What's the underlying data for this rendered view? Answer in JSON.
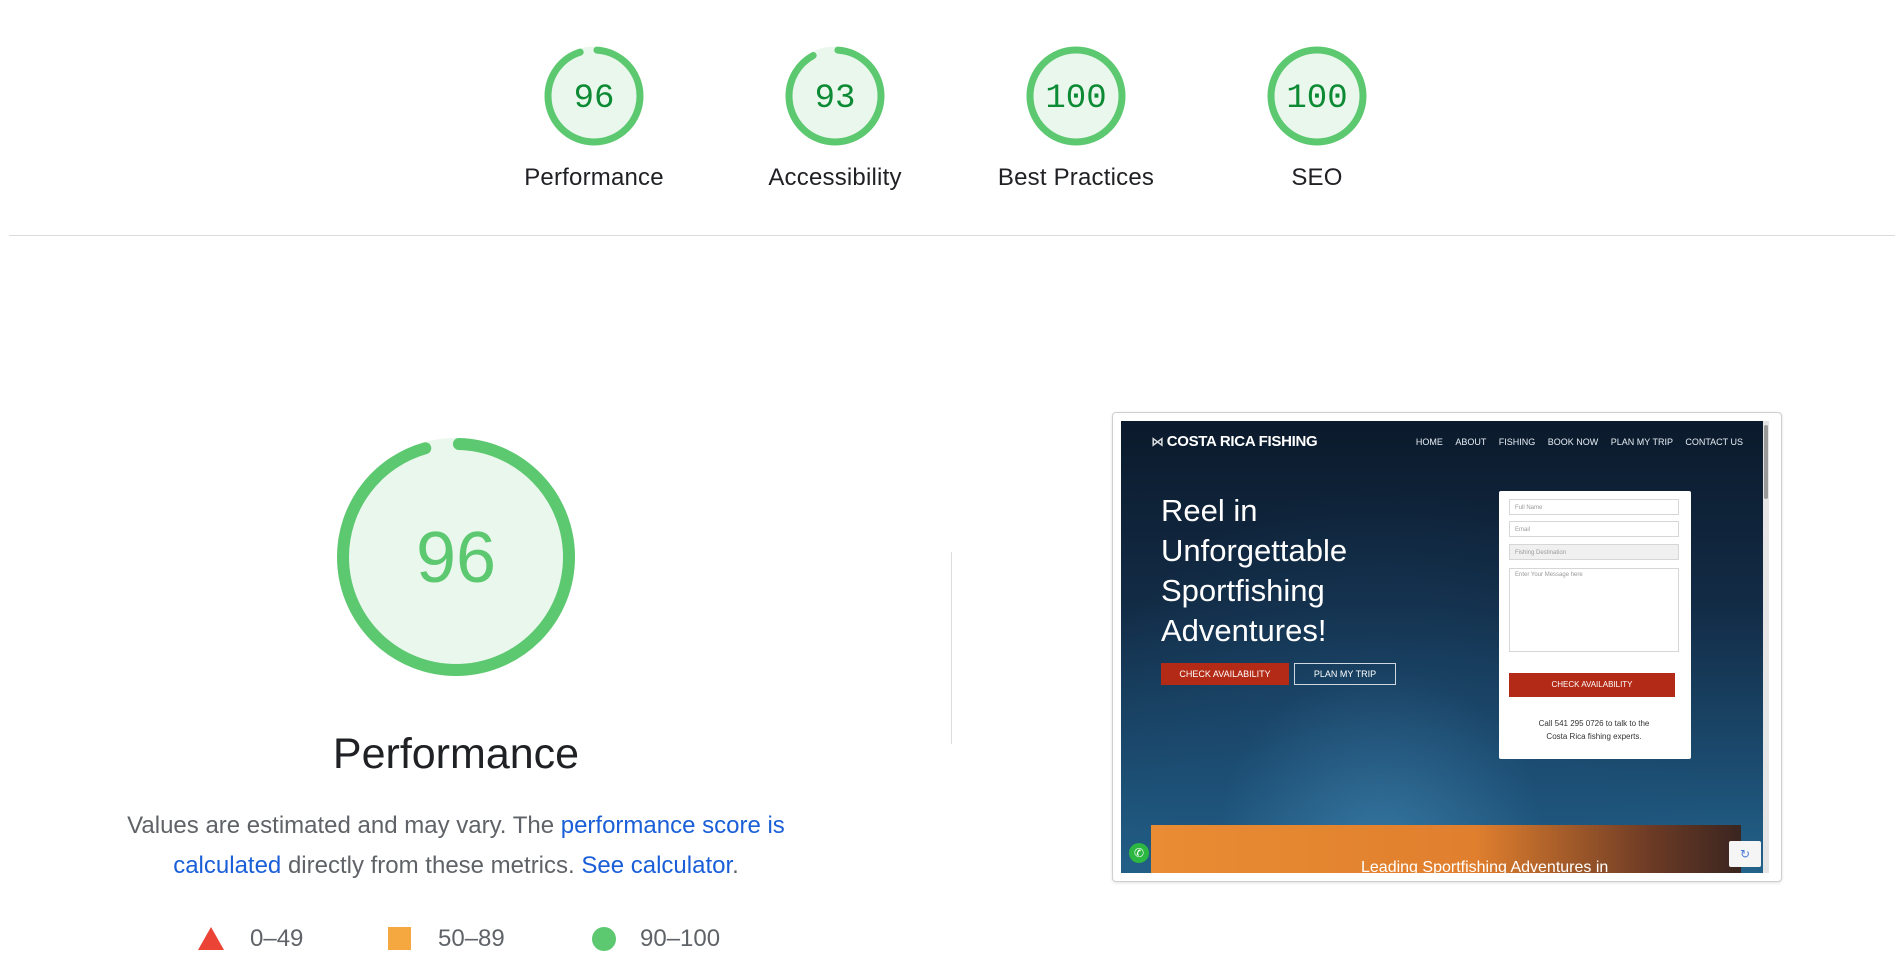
{
  "colors": {
    "pass_green": "#0c8a34",
    "pass_ring": "#5cc86f",
    "pass_fill": "#eaf7ed",
    "link_blue": "#1a5fd8",
    "fail_red": "#eb4335",
    "average_orange": "#f4a83f"
  },
  "gauges": [
    {
      "score": "96",
      "score_value": 96,
      "label": "Performance"
    },
    {
      "score": "93",
      "score_value": 93,
      "label": "Accessibility"
    },
    {
      "score": "100",
      "score_value": 100,
      "label": "Best Practices"
    },
    {
      "score": "100",
      "score_value": 100,
      "label": "SEO"
    }
  ],
  "main": {
    "score": "96",
    "score_value": 96,
    "title": "Performance",
    "description_1": "Values are estimated and may vary. The ",
    "link_score": "performance score is calculated",
    "description_2": " directly from these metrics. ",
    "link_calculator": "See calculator",
    "description_3": ".",
    "legend": [
      {
        "icon": "fail-triangle-icon",
        "range": "0–49"
      },
      {
        "icon": "average-square-icon",
        "range": "50–89"
      },
      {
        "icon": "pass-circle-icon",
        "range": "90–100"
      }
    ]
  },
  "screenshot": {
    "logo": "COSTA RICA FISHING",
    "nav": [
      "HOME",
      "ABOUT",
      "FISHING",
      "BOOK NOW",
      "PLAN MY TRIP",
      "CONTACT US"
    ],
    "hero_line1": "Reel in",
    "hero_line2": "Unforgettable",
    "hero_line3": "Sportfishing",
    "hero_line4": "Adventures!",
    "btn_check": "CHECK AVAILABILITY",
    "btn_plan": "PLAN MY TRIP",
    "form_name": "Full Name",
    "form_email": "Email",
    "form_destination": "Fishing Destination",
    "form_message": "Enter Your Message here",
    "form_cta": "CHECK AVAILABILITY",
    "form_call_1": "Call 541 295 0726 to talk to the",
    "form_call_2": "Costa Rica fishing experts.",
    "band_text": "Leading Sportfishing Adventures in"
  }
}
